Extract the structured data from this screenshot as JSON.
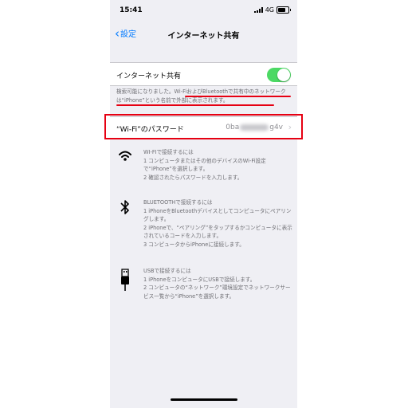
{
  "status_bar": {
    "time": "15:41",
    "network": "4G"
  },
  "nav": {
    "back_label": "設定",
    "title": "インターネット共有"
  },
  "tethering": {
    "label": "インターネット共有",
    "enabled": true
  },
  "footnote": {
    "part1": "検索可能になりました。",
    "part2": "Wi-FiおよびBluetoothで共有中のネットワークは“iPhone”という名前で外部に表示されます。"
  },
  "password_row": {
    "label": "“Wi-Fi”のパスワード",
    "prefix": "0ba",
    "suffix": "g4v"
  },
  "sections": [
    {
      "icon": "wifi-icon",
      "heading": "WI-FIで接続するには",
      "steps": [
        "1 コンピュータまたはその他のデバイスのWi-Fi設定で“iPhone”を選択します。",
        "2 確認されたらパスワードを入力します。"
      ]
    },
    {
      "icon": "bluetooth-icon",
      "heading": "BLUETOOTHで接続するには",
      "steps": [
        "1 iPhoneをBluetoothデバイスとしてコンピュータにペアリングします。",
        "2 iPhoneで、“ペアリング”をタップするかコンピュータに表示されているコードを入力します。",
        "3 コンピュータからiPhoneに接続します。"
      ]
    },
    {
      "icon": "usb-icon",
      "heading": "USBで接続するには",
      "steps": [
        "1 iPhoneをコンピュータにUSBで接続します。",
        "2 コンピュータの“ネットワーク”環境設定でネットワークサービス一覧から“iPhone”を選択します。"
      ]
    }
  ],
  "colors": {
    "accent": "#007aff",
    "toggle_on": "#4cd964",
    "annotation_red": "#e60012"
  }
}
